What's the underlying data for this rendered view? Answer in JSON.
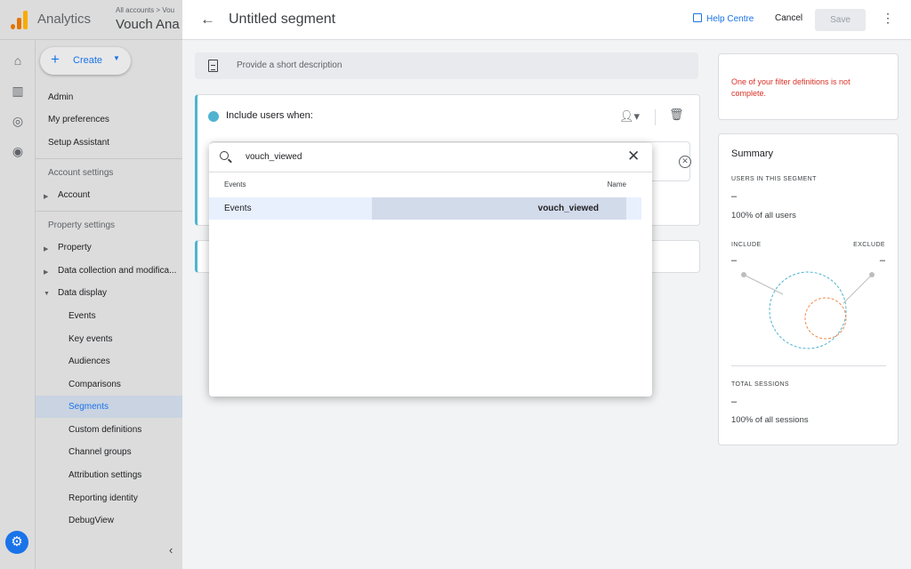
{
  "app": {
    "title": "Analytics",
    "breadcrumb": "All accounts > Vou",
    "property": "Vouch Ana"
  },
  "nav": {
    "create_label": "Create",
    "admin": "Admin",
    "my_preferences": "My preferences",
    "setup_assistant": "Setup Assistant",
    "account_settings_header": "Account settings",
    "account": "Account",
    "property_settings_header": "Property settings",
    "property": "Property",
    "data_collection": "Data collection and modifica...",
    "data_display": "Data display",
    "sub_items": [
      "Events",
      "Key events",
      "Audiences",
      "Comparisons",
      "Segments",
      "Custom definitions",
      "Channel groups",
      "Attribution settings",
      "Reporting identity",
      "DebugView"
    ],
    "selected": "Segments"
  },
  "segment": {
    "title": "Untitled segment",
    "help_label": "Help Centre",
    "cancel_label": "Cancel",
    "save_label": "Save",
    "description_placeholder": "Provide a short description",
    "include_title": "Include users when:"
  },
  "error": {
    "message": "One of your filter definitions is not complete."
  },
  "summary": {
    "title": "Summary",
    "users_caption": "USERS IN THIS SEGMENT",
    "users_value": "–",
    "users_sub": "100% of all users",
    "include_caption": "INCLUDE",
    "include_value": "–",
    "exclude_caption": "EXCLUDE",
    "exclude_value": "–",
    "sessions_caption": "TOTAL SESSIONS",
    "sessions_value": "–",
    "sessions_sub": "100% of all sessions",
    "colors": {
      "users_ring": "#4fb3d0",
      "exclude_ring": "#f08a4b"
    }
  },
  "dropdown": {
    "search_value": "vouch_viewed",
    "col_events": "Events",
    "col_name": "Name",
    "result_category": "Events",
    "result_value": "vouch_viewed"
  }
}
